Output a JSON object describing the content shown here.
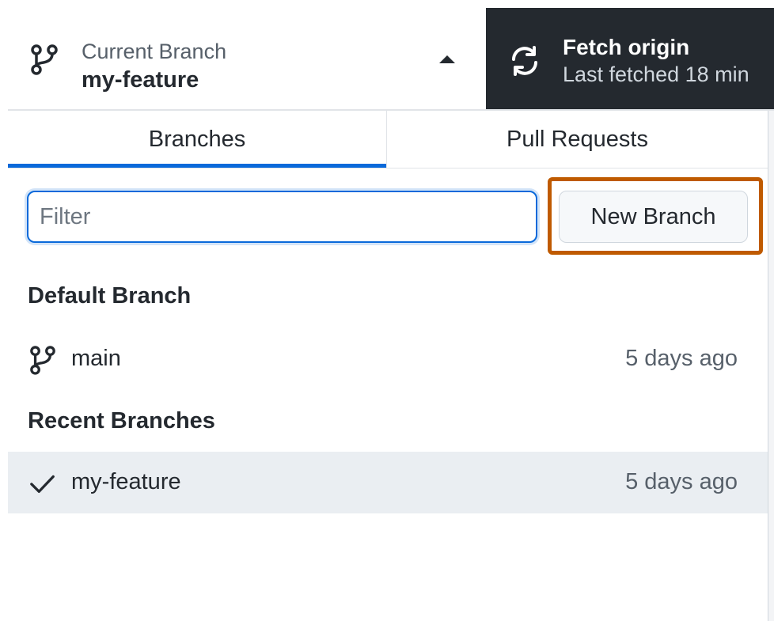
{
  "toolbar": {
    "current_branch": {
      "label": "Current Branch",
      "value": "my-feature",
      "icon": "git-branch-icon",
      "toggle_icon": "caret-up-icon"
    },
    "fetch": {
      "title": "Fetch origin",
      "subtitle": "Last fetched 18 min",
      "icon": "sync-icon"
    }
  },
  "tabs": [
    {
      "label": "Branches",
      "selected": true
    },
    {
      "label": "Pull Requests",
      "selected": false
    }
  ],
  "filter": {
    "placeholder": "Filter",
    "value": ""
  },
  "new_branch_button": {
    "label": "New Branch",
    "highlight_color": "#bf5a00"
  },
  "default_branch": {
    "header": "Default Branch",
    "items": [
      {
        "name": "main",
        "time": "5 days ago",
        "icon": "git-branch-icon"
      }
    ]
  },
  "recent_branches": {
    "header": "Recent Branches",
    "items": [
      {
        "name": "my-feature",
        "time": "5 days ago",
        "icon": "check-icon",
        "current": true
      }
    ]
  },
  "colors": {
    "accent": "#0969da",
    "toolbar_dark": "#24292f",
    "selected_row": "#eaeef2",
    "highlight": "#bf5a00"
  }
}
